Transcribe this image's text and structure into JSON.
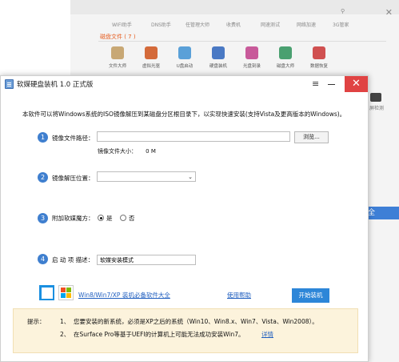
{
  "background_app": {
    "tabs": [
      "WIFI助手",
      "DNS助手",
      "任管理大师",
      "收费机",
      "网速测试",
      "网络加速",
      "3G管家"
    ],
    "category": "磁盘文件 ( 7 )",
    "tools": [
      {
        "label": "文件大师",
        "color": "#c8a875"
      },
      {
        "label": "虚拟光驱",
        "color": "#d46a3a"
      },
      {
        "label": "U盘启动",
        "color": "#5aa0d8"
      },
      {
        "label": "硬盘装机",
        "color": "#4a79c4"
      },
      {
        "label": "光盘刻录",
        "color": "#c85a9a"
      },
      {
        "label": "磁盘大师",
        "color": "#4aa070"
      },
      {
        "label": "数据恢复",
        "color": "#d05050"
      }
    ],
    "right_band_text": "全",
    "right_tool_label": "屏检测"
  },
  "window": {
    "title": "软媒硬盘装机 1.0 正式版",
    "menu_icon": "hamburger-icon",
    "min_icon": "minimize-icon",
    "close_icon": "close-icon",
    "close_glyph": "✕"
  },
  "description": "本软件可以将Windows系统的ISO镜像解压到某磁盘分区根目录下，以实现快速安装(支持Vista及更高版本的Windows)。",
  "steps": {
    "s1": {
      "num": "1",
      "label": "镜像文件路径：",
      "value": "",
      "placeholder": "",
      "browse_label": "浏览...",
      "size_label": "镜像文件大小：",
      "size_value": "0 M"
    },
    "s2": {
      "num": "2",
      "label": "镜像解压位置：",
      "selected": ""
    },
    "s3": {
      "num": "3",
      "label": "附加软媒魔方：",
      "yes": "是",
      "no": "否",
      "selected": "是"
    },
    "s4": {
      "num": "4",
      "label": "启 动 项 描述：",
      "value": "软媒安装模式"
    }
  },
  "links": {
    "software": "Win8/Win7/XP 装机必备软件大全",
    "help": "使用帮助"
  },
  "start_button": "开始装机",
  "tips": {
    "head": "提示：",
    "line1_num": "1、",
    "line1": "您要安装的新系统，必须是XP之后的系统（Win10、Win8.x、Win7、Vista、Win2008）。",
    "line2_num": "2、",
    "line2": "在Surface Pro等基于UEFI的计算机上可能无法成功安装Win7。",
    "detail_link": "详情"
  }
}
